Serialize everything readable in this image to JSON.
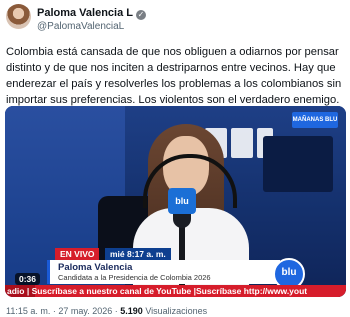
{
  "author": {
    "name": "Paloma Valencia L",
    "handle": "@PalomaValenciaL"
  },
  "tweet": {
    "text": "Colombia está cansada de que nos obliguen a odiarnos por pensar distinto y de que nos inciten a destriparnos entre vecinos. Hay que enderezar el país y resolverles los problemas a los colombianos sin importar sus preferencias. Los violentos son el verdadero enemigo."
  },
  "video": {
    "live_label": "EN VIVO",
    "date_label": "mié 8:17 a. m.",
    "lower_third_name": "Paloma Valencia",
    "lower_third_subtitle": "Candidata a la Presidencia de Colombia 2026",
    "ticker_text": "adio | Suscríbase a nuestro canal de YouTube |Suscríbase http://www.yout",
    "elapsed": "0:36",
    "mic_logo": "blu",
    "badge_logo": "blu",
    "top_logo": "MAÑANAS BLU"
  },
  "footer": {
    "time": "11:15 a. m.",
    "date": "27 may. 2026",
    "views_count": "5.190",
    "views_label": "Visualizaciones"
  }
}
